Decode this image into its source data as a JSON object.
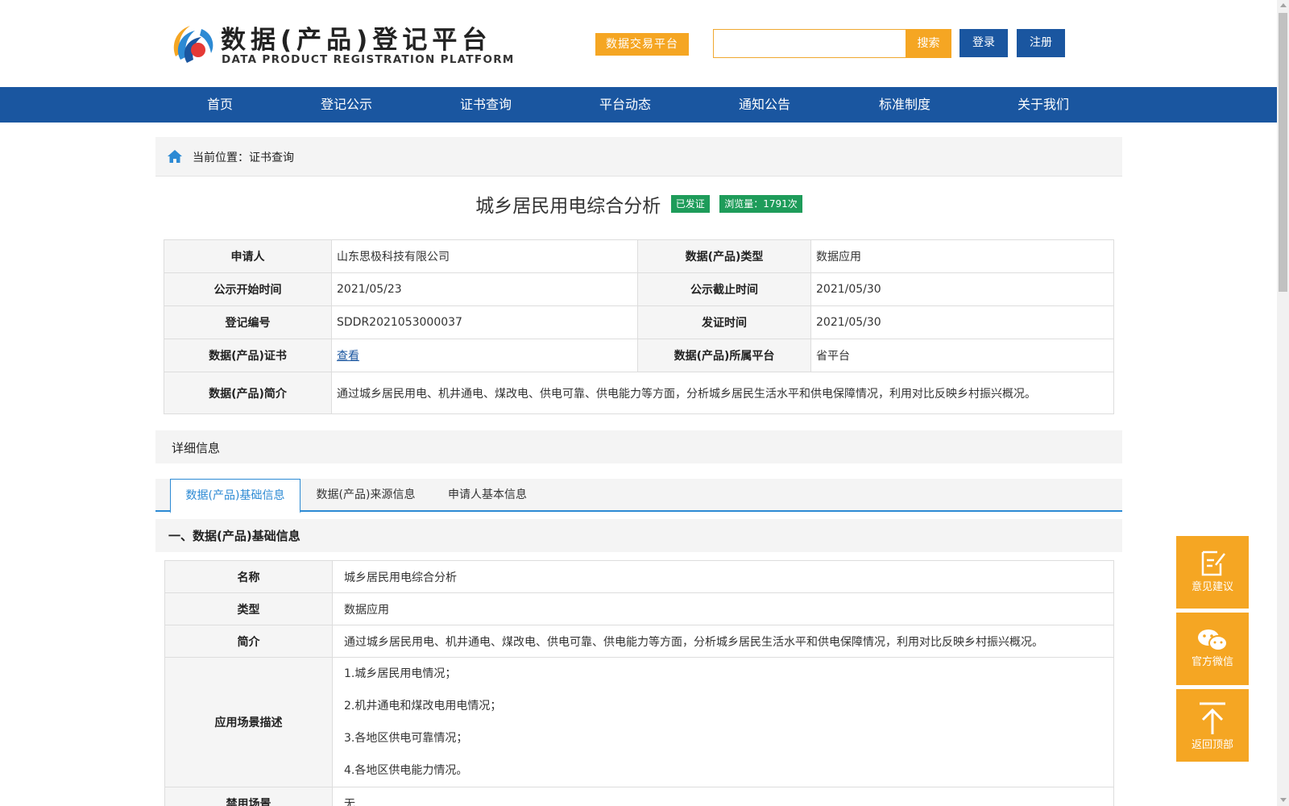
{
  "header": {
    "logo_title": "数据(产品)登记平台",
    "logo_subtitle": "DATA PRODUCT REGISTRATION PLATFORM",
    "exchange_label": "数据交易平台",
    "search_placeholder": "",
    "search_label": "搜索",
    "login_label": "登录",
    "register_label": "注册"
  },
  "nav": {
    "items": [
      "首页",
      "登记公示",
      "证书查询",
      "平台动态",
      "通知公告",
      "标准制度",
      "关于我们"
    ]
  },
  "breadcrumb": {
    "text": "当前位置：证书查询"
  },
  "title": {
    "text": "城乡居民用电综合分析",
    "status_badge": "已发证",
    "views_badge": "浏览量：1791次"
  },
  "summary": {
    "applicant_label": "申请人",
    "applicant": "山东思极科技有限公司",
    "type_label": "数据(产品)类型",
    "type": "数据应用",
    "start_label": "公示开始时间",
    "start": "2021/05/23",
    "end_label": "公示截止时间",
    "end": "2021/05/30",
    "reg_no_label": "登记编号",
    "reg_no": "SDDR2021053000037",
    "issue_label": "发证时间",
    "issue": "2021/05/30",
    "cert_label": "数据(产品)证书",
    "cert_link": "查看",
    "platform_label": "数据(产品)所属平台",
    "platform": "省平台",
    "intro_label": "数据(产品)简介",
    "intro": "通过城乡居民用电、机井通电、煤改电、供电可靠、供电能力等方面，分析城乡居民生活水平和供电保障情况，利用对比反映乡村振兴概况。"
  },
  "detail": {
    "header": "详细信息",
    "tabs": [
      "数据(产品)基础信息",
      "数据(产品)来源信息",
      "申请人基本信息"
    ],
    "section_title": "一、数据(产品)基础信息",
    "name_label": "名称",
    "name": "城乡居民用电综合分析",
    "type_label": "类型",
    "type": "数据应用",
    "intro_label": "简介",
    "intro": "通过城乡居民用电、机井通电、煤改电、供电可靠、供电能力等方面，分析城乡居民生活水平和供电保障情况，利用对比反映乡村振兴概况。",
    "scene_label": "应用场景描述",
    "scenes": [
      "1.城乡居民用电情况；",
      "2.机井通电和煤改电用电情况；",
      "3.各地区供电可靠情况；",
      "4.各地区供电能力情况。"
    ],
    "banned_label": "禁用场景",
    "banned": "无"
  },
  "float": {
    "feedback": "意见建议",
    "wechat": "官方微信",
    "top": "返回顶部"
  },
  "colors": {
    "brand_blue": "#1a56a0",
    "accent_orange": "#f5a623",
    "badge_green": "#1e9c5a",
    "tab_blue": "#2c8ad4"
  }
}
